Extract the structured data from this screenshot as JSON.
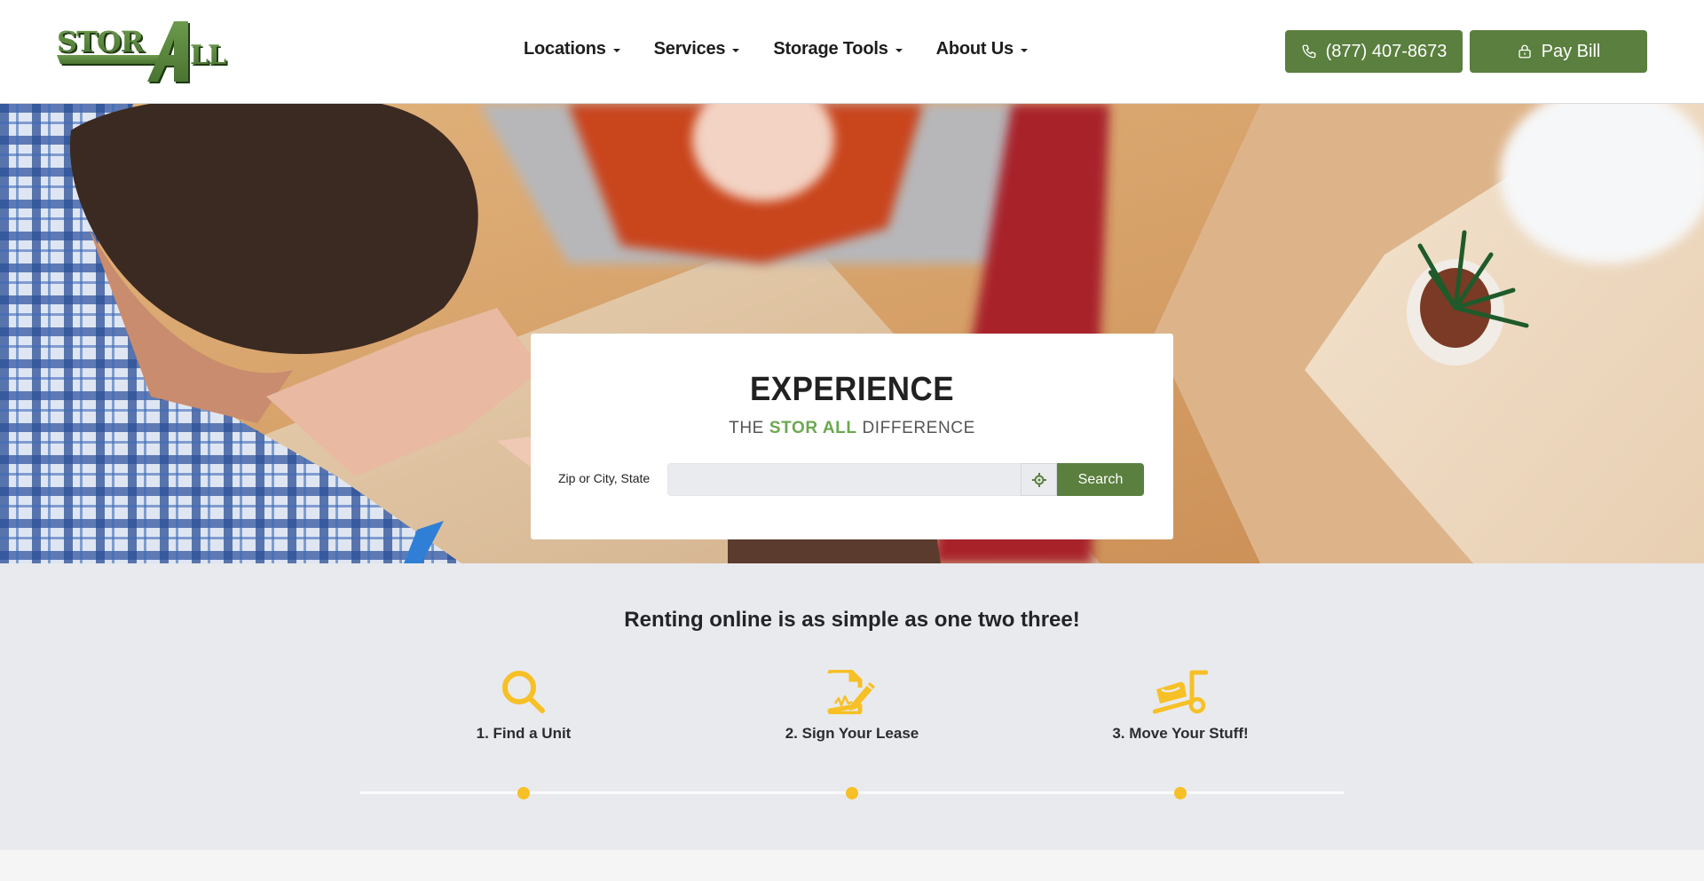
{
  "header": {
    "logo_alt": "STOR ALL",
    "nav": [
      {
        "label": "Locations"
      },
      {
        "label": "Services"
      },
      {
        "label": "Storage Tools"
      },
      {
        "label": "About Us"
      }
    ],
    "phone_button": {
      "label": "(877) 407-8673",
      "icon": "phone-icon"
    },
    "pay_button": {
      "label": "Pay Bill",
      "icon": "lock-icon"
    }
  },
  "hero": {
    "title": "EXPERIENCE",
    "subtitle_prefix": "THE",
    "subtitle_brand": "STOR ALL",
    "subtitle_suffix": "DIFFERENCE",
    "search": {
      "label": "Zip or City, State",
      "value": "",
      "placeholder": "",
      "locate_icon": "crosshair-icon",
      "button_label": "Search"
    }
  },
  "steps": {
    "heading": "Renting online is as simple as one two three!",
    "items": [
      {
        "label": "1. Find a Unit",
        "icon": "search-icon"
      },
      {
        "label": "2. Sign Your Lease",
        "icon": "sign-document-icon"
      },
      {
        "label": "3. Move Your Stuff!",
        "icon": "hand-truck-icon"
      }
    ]
  },
  "colors": {
    "brand_green": "#5a7f3e",
    "brand_light_green": "#6aa84f",
    "accent_yellow": "#f6c026",
    "section_bg": "#e9eaed"
  }
}
